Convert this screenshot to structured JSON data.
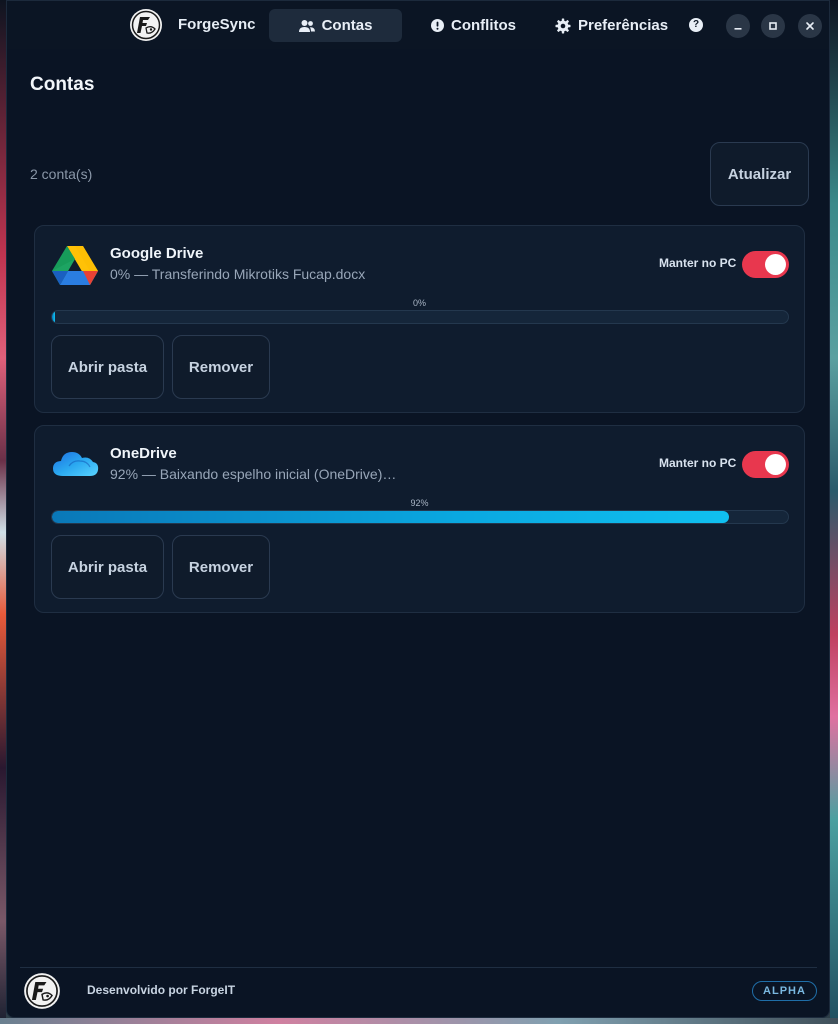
{
  "app": {
    "name": "ForgeSync",
    "accent_color": "#e8374e",
    "progress_color": "#0aa8e0"
  },
  "nav": {
    "tabs": [
      {
        "label": "Contas",
        "icon": "users-icon",
        "active": true
      },
      {
        "label": "Conflitos",
        "icon": "alert-circle-icon",
        "active": false
      },
      {
        "label": "Preferências",
        "icon": "gear-icon",
        "active": false
      }
    ],
    "help_label": "?"
  },
  "main": {
    "title": "Contas",
    "count_text": "2 conta(s)",
    "refresh_label": "Atualizar"
  },
  "accounts": [
    {
      "provider": "Google Drive",
      "icon": "google-drive-icon",
      "status": "0% — Transferindo Mikrotiks Fucap.docx",
      "keep_label": "Manter no PC",
      "keep_on": true,
      "progress": 0,
      "progress_label": "0%",
      "open_label": "Abrir pasta",
      "remove_label": "Remover"
    },
    {
      "provider": "OneDrive",
      "icon": "onedrive-cloud-icon",
      "status": "92% — Baixando espelho inicial (OneDrive)…",
      "keep_label": "Manter no PC",
      "keep_on": true,
      "progress": 92,
      "progress_label": "92%",
      "open_label": "Abrir pasta",
      "remove_label": "Remover"
    }
  ],
  "footer": {
    "developer_text": "Desenvolvido por ForgeIT",
    "badge": "ALPHA"
  }
}
